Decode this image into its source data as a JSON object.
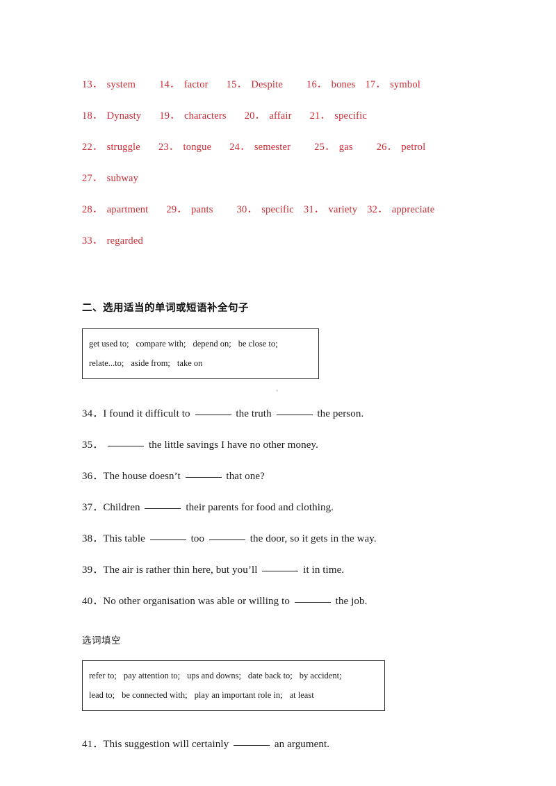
{
  "document": {
    "answer_key": {
      "lines": [
        {
          "items": [
            {
              "num": "13．",
              "word": "system"
            },
            {
              "num": "14．",
              "word": "factor"
            },
            {
              "num": "15．",
              "word": "Despite"
            },
            {
              "num": "16．",
              "word": "bones"
            },
            {
              "num": "17．",
              "word": "symbol"
            }
          ]
        },
        {
          "items": [
            {
              "num": "18．",
              "word": "Dynasty"
            },
            {
              "num": "19．",
              "word": "characters"
            },
            {
              "num": "20．",
              "word": "affair"
            },
            {
              "num": "21．",
              "word": "specific"
            }
          ]
        },
        {
          "items": [
            {
              "num": "22．",
              "word": "struggle"
            },
            {
              "num": "23．",
              "word": "tongue"
            },
            {
              "num": "24．",
              "word": "semester"
            },
            {
              "num": "25．",
              "word": "gas"
            },
            {
              "num": "26．",
              "word": "petrol"
            }
          ]
        },
        {
          "items": [
            {
              "num": "27．",
              "word": "subway"
            }
          ]
        },
        {
          "items": [
            {
              "num": "28．",
              "word": "apartment"
            },
            {
              "num": "29．",
              "word": "pants"
            },
            {
              "num": "30．",
              "word": "specific"
            },
            {
              "num": "31．",
              "word": "variety"
            },
            {
              "num": "32．",
              "word": "appreciate"
            }
          ]
        },
        {
          "items": [
            {
              "num": "33．",
              "word": "regarded"
            }
          ]
        }
      ],
      "color": "#cc2a33"
    },
    "section_two": {
      "heading": "二、选用适当的单词或短语补全句子",
      "wordbank": {
        "rows": [
          [
            "get used to;",
            "compare with;",
            "depend on;",
            "be close to;"
          ],
          [
            "relate...to;",
            "aside from;",
            "take on"
          ]
        ]
      },
      "questions": [
        {
          "num": "34．",
          "parts": [
            "I found it difficult to ",
            " the truth ",
            " the person."
          ],
          "blanks": 2
        },
        {
          "num": "35．",
          "parts": [
            " ",
            " the little savings I have no other money."
          ],
          "blanks": 1
        },
        {
          "num": "36．",
          "parts": [
            "The house doesn’t ",
            " that one?"
          ],
          "blanks": 1
        },
        {
          "num": "37．",
          "parts": [
            "Children ",
            " their parents for food and clothing."
          ],
          "blanks": 1
        },
        {
          "num": "38．",
          "parts": [
            "This table ",
            " too ",
            " the door, so it gets in the way."
          ],
          "blanks": 2
        },
        {
          "num": "39．",
          "parts": [
            "The air is rather thin here, but you’ll ",
            " it in time."
          ],
          "blanks": 1
        },
        {
          "num": "40．",
          "parts": [
            "No other organisation was able or willing to ",
            " the job."
          ],
          "blanks": 1
        }
      ]
    },
    "section_three": {
      "label": "选词填空",
      "wordbank": {
        "rows": [
          [
            "refer to;",
            "pay attention to;",
            "ups and downs;",
            "date back to;",
            "by accident;"
          ],
          [
            "lead to;",
            "be connected with;",
            "play an important role in;",
            "at least"
          ]
        ]
      },
      "questions": [
        {
          "num": "41．",
          "parts": [
            "This suggestion will certainly ",
            " an argument."
          ],
          "blanks": 1
        }
      ]
    }
  }
}
